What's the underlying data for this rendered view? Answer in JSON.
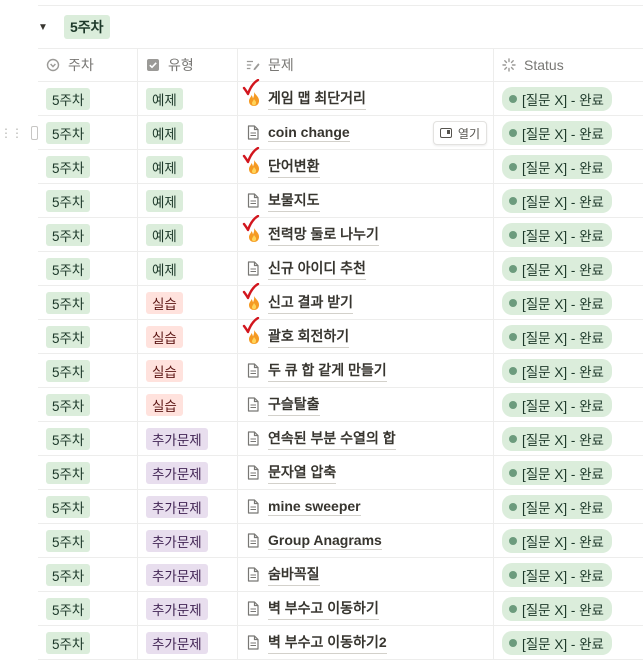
{
  "group": {
    "label": "5주차"
  },
  "columns": {
    "week": "주차",
    "type": "유형",
    "problem": "문제",
    "status": "Status"
  },
  "open_button_label": "열기",
  "rows": [
    {
      "week": "5주차",
      "type": "예제",
      "type_style": "ex",
      "title": "게임 맵 최단거리",
      "icon": "fire",
      "checked": true,
      "status": "[질문 X] - 완료"
    },
    {
      "week": "5주차",
      "type": "예제",
      "type_style": "ex",
      "title": "coin change",
      "icon": "page",
      "checked": false,
      "status": "[질문 X] - 완료",
      "hover": true
    },
    {
      "week": "5주차",
      "type": "예제",
      "type_style": "ex",
      "title": "단어변환",
      "icon": "fire",
      "checked": true,
      "status": "[질문 X] - 완료"
    },
    {
      "week": "5주차",
      "type": "예제",
      "type_style": "ex",
      "title": "보물지도",
      "icon": "page",
      "checked": false,
      "status": "[질문 X] - 완료"
    },
    {
      "week": "5주차",
      "type": "예제",
      "type_style": "ex",
      "title": "전력망 둘로 나누기",
      "icon": "fire",
      "checked": true,
      "status": "[질문 X] - 완료"
    },
    {
      "week": "5주차",
      "type": "예제",
      "type_style": "ex",
      "title": "신규 아이디 추천",
      "icon": "page",
      "checked": false,
      "status": "[질문 X] - 완료"
    },
    {
      "week": "5주차",
      "type": "실습",
      "type_style": "prac",
      "title": "신고 결과 받기",
      "icon": "fire",
      "checked": true,
      "status": "[질문 X] - 완료"
    },
    {
      "week": "5주차",
      "type": "실습",
      "type_style": "prac",
      "title": "괄호 회전하기",
      "icon": "fire",
      "checked": true,
      "status": "[질문 X] - 완료"
    },
    {
      "week": "5주차",
      "type": "실습",
      "type_style": "prac",
      "title": "두 큐 합 같게 만들기",
      "icon": "page",
      "checked": false,
      "status": "[질문 X] - 완료"
    },
    {
      "week": "5주차",
      "type": "실습",
      "type_style": "prac",
      "title": "구슬탈출",
      "icon": "page",
      "checked": false,
      "status": "[질문 X] - 완료"
    },
    {
      "week": "5주차",
      "type": "추가문제",
      "type_style": "add",
      "title": "연속된 부분 수열의 합",
      "icon": "page",
      "checked": false,
      "status": "[질문 X] - 완료"
    },
    {
      "week": "5주차",
      "type": "추가문제",
      "type_style": "add",
      "title": "문자열 압축",
      "icon": "page",
      "checked": false,
      "status": "[질문 X] - 완료"
    },
    {
      "week": "5주차",
      "type": "추가문제",
      "type_style": "add",
      "title": "mine sweeper",
      "icon": "page",
      "checked": false,
      "status": "[질문 X] - 완료"
    },
    {
      "week": "5주차",
      "type": "추가문제",
      "type_style": "add",
      "title": "Group Anagrams",
      "icon": "page",
      "checked": false,
      "status": "[질문 X] - 완료"
    },
    {
      "week": "5주차",
      "type": "추가문제",
      "type_style": "add",
      "title": "숨바꼭질",
      "icon": "page",
      "checked": false,
      "status": "[질문 X] - 완료"
    },
    {
      "week": "5주차",
      "type": "추가문제",
      "type_style": "add",
      "title": "벽 부수고 이동하기",
      "icon": "page",
      "checked": false,
      "status": "[질문 X] - 완료"
    },
    {
      "week": "5주차",
      "type": "추가문제",
      "type_style": "add",
      "title": "벽 부수고 이동하기2",
      "icon": "page",
      "checked": false,
      "status": "[질문 X] - 완료"
    }
  ],
  "colors": {
    "green_tag": "#dbeddb",
    "red_tag": "#ffe2dd",
    "purple_tag": "#e8deee",
    "status_dot": "#6c9b7d",
    "check_mark": "#d2161e"
  }
}
